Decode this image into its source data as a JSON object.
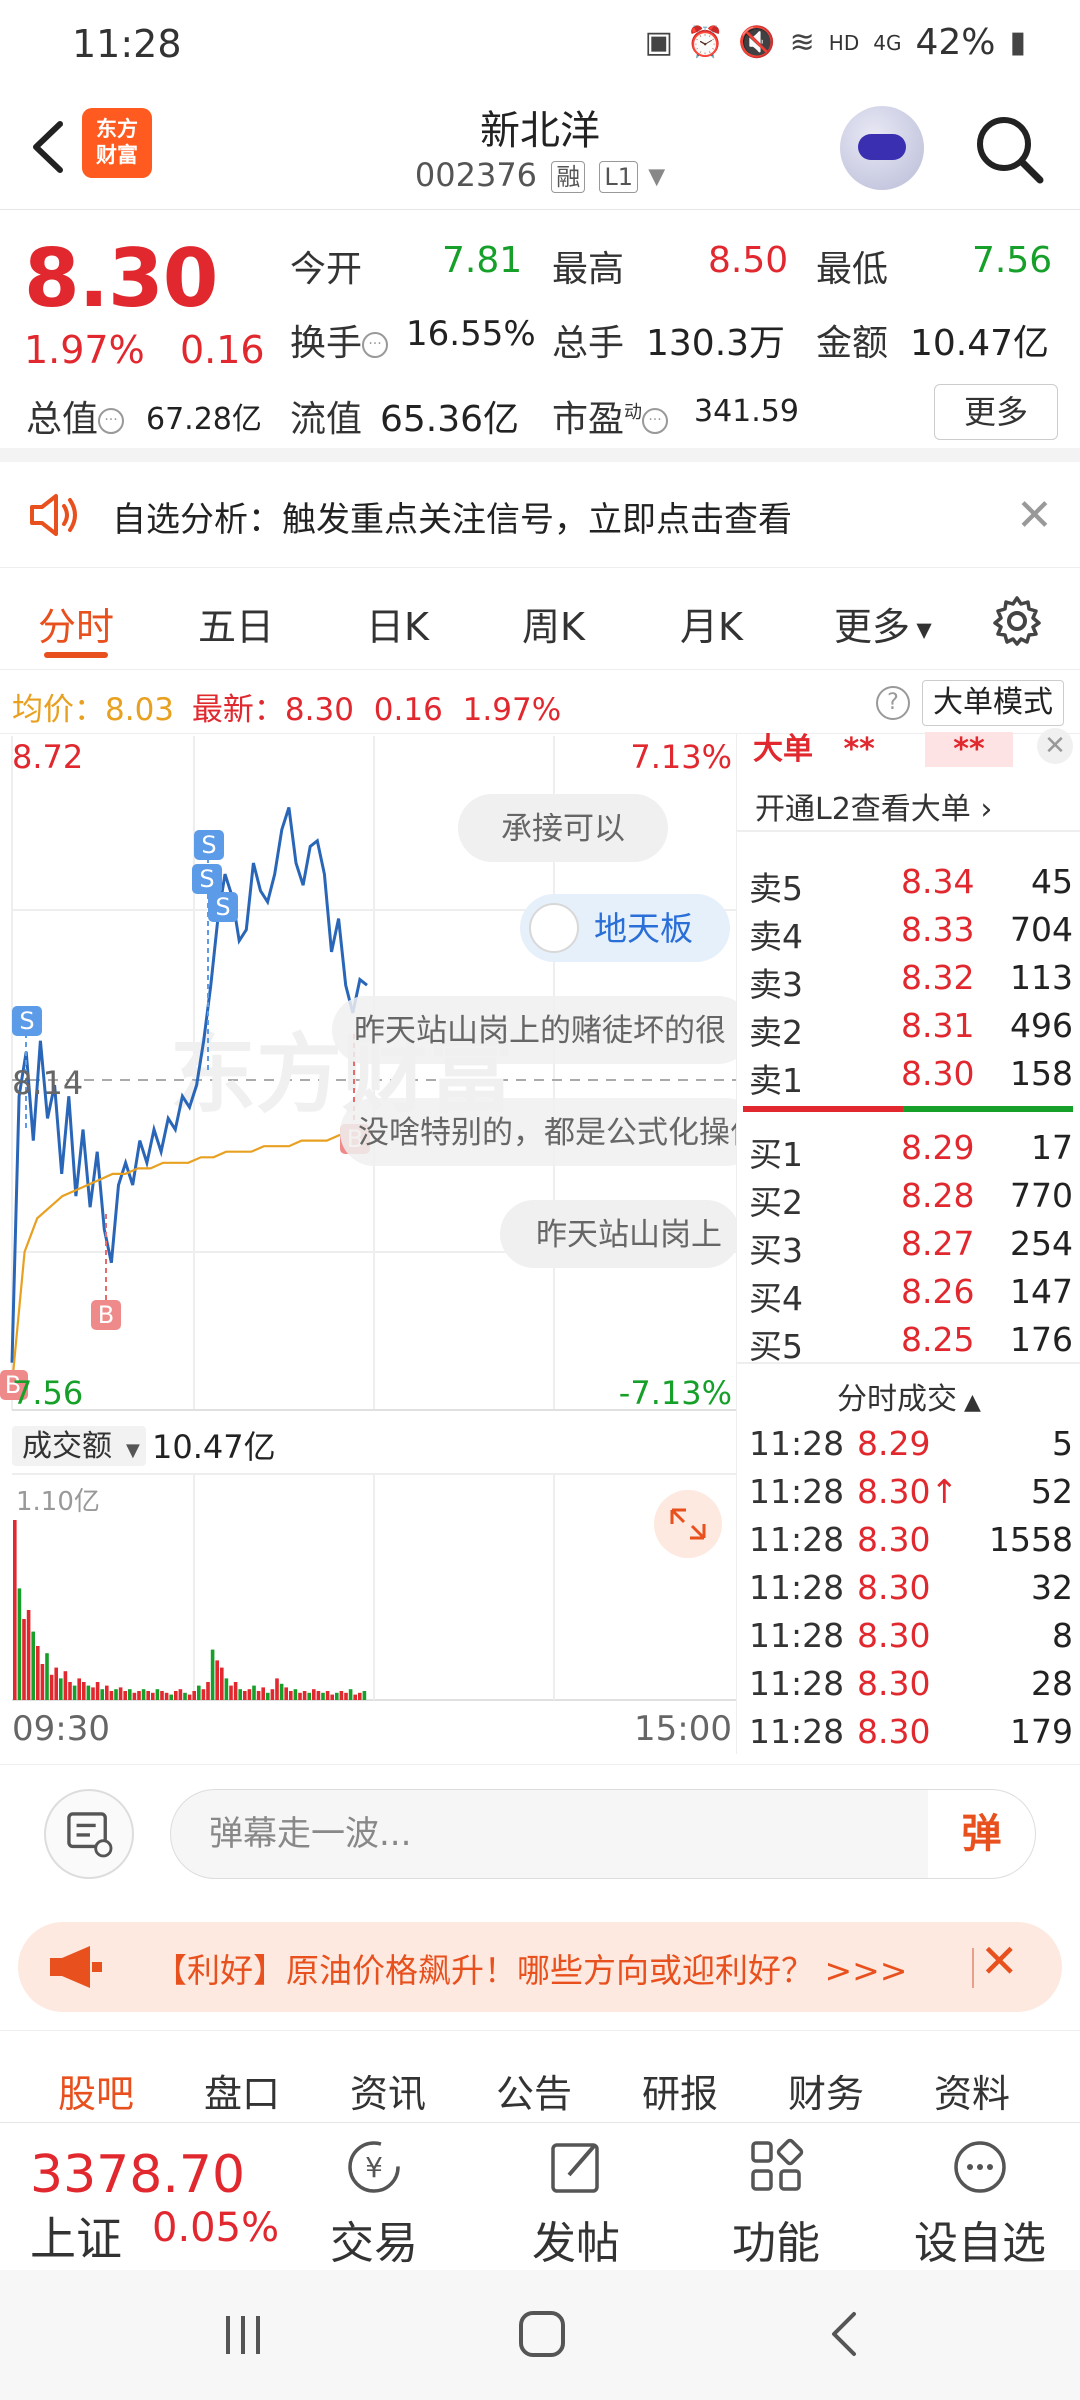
{
  "status_bar": {
    "time": "11:28",
    "network": "HD",
    "signal": "4G",
    "battery": "42%"
  },
  "header": {
    "logo_line1": "东方",
    "logo_line2": "财富",
    "stock_name": "新北洋",
    "stock_code": "002376",
    "tag_margin": "融",
    "tag_level": "L1"
  },
  "quote": {
    "price": "8.30",
    "change_pct": "1.97%",
    "change": "0.16",
    "open_label": "今开",
    "open": "7.81",
    "high_label": "最高",
    "high": "8.50",
    "low_label": "最低",
    "low": "7.56",
    "turnover_label": "换手",
    "turnover": "16.55%",
    "volume_label": "总手",
    "volume": "130.3万",
    "amount_label": "金额",
    "amount": "10.47亿",
    "mcap_label": "总值",
    "mcap": "67.28亿",
    "float_label": "流值",
    "float": "65.36亿",
    "pe_label": "市盈",
    "pe_sup": "动",
    "pe": "341.59",
    "more": "更多"
  },
  "notice": {
    "text": "自选分析：触发重点关注信号，立即点击查看"
  },
  "tabs": [
    "分时",
    "五日",
    "日K",
    "周K",
    "月K",
    "更多"
  ],
  "avg_row": {
    "avg_label": "均价：",
    "avg_value": "8.03",
    "latest_label": "最新：",
    "latest_value": "8.30",
    "latest_change": "0.16",
    "latest_pct": "1.97%",
    "help": "?",
    "big_mode": "大单模式"
  },
  "chart": {
    "y_high": "8.72",
    "y_mid": "8.14",
    "y_low": "7.56",
    "pct_high": "7.13%",
    "pct_low": "-7.13%",
    "time_start": "09:30",
    "time_end": "15:00",
    "bubbles": [
      "承接可以",
      "地天板",
      "昨天站山岗上的赌徒坏的很",
      "没啥特别的，都是公式化操作",
      "昨天站山岗上"
    ],
    "signals": {
      "sell": "S",
      "buy": "B"
    },
    "watermark": "东方财富"
  },
  "chart_data": {
    "type": "line",
    "ylim": [
      7.56,
      8.72
    ],
    "series": [
      {
        "values": [
          7.62,
          8.1,
          8.18,
          8.02,
          8.2,
          8.06,
          8.12,
          7.96,
          8.1,
          7.92,
          8.04,
          7.9,
          8.0,
          7.86,
          7.8,
          7.94,
          7.98,
          7.94,
          8.02,
          7.98,
          8.04,
          8.0,
          8.06,
          8.04,
          8.1,
          8.08,
          8.12,
          8.2,
          8.3,
          8.42,
          8.5,
          8.46,
          8.38,
          8.4,
          8.52,
          8.47,
          8.45,
          8.5,
          8.58,
          8.62,
          8.52,
          8.48,
          8.55,
          8.56,
          8.5,
          8.36,
          8.42,
          8.3,
          8.25,
          8.31,
          8.3
        ]
      },
      {
        "values": [
          7.58,
          7.82,
          7.88,
          7.9,
          7.92,
          7.93,
          7.94,
          7.95,
          7.96,
          7.96,
          7.97,
          7.97,
          7.98,
          7.98,
          7.98,
          7.99,
          7.99,
          8.0,
          8.0,
          8.0,
          8.01,
          8.01,
          8.01,
          8.02,
          8.02,
          8.02,
          8.03,
          8.03
        ]
      }
    ]
  },
  "volume": {
    "label": "成交额",
    "value": "10.47亿",
    "max_label": "1.10亿"
  },
  "book": {
    "title": "大单",
    "title_note1": "**",
    "title_note2": "**",
    "l2_link": "开通L2查看大单",
    "asks": [
      {
        "l": "卖5",
        "p": "8.34",
        "v": "45"
      },
      {
        "l": "卖4",
        "p": "8.33",
        "v": "704"
      },
      {
        "l": "卖3",
        "p": "8.32",
        "v": "113"
      },
      {
        "l": "卖2",
        "p": "8.31",
        "v": "496"
      },
      {
        "l": "卖1",
        "p": "8.30",
        "v": "158"
      }
    ],
    "bids": [
      {
        "l": "买1",
        "p": "8.29",
        "v": "17"
      },
      {
        "l": "买2",
        "p": "8.28",
        "v": "770"
      },
      {
        "l": "买3",
        "p": "8.27",
        "v": "254"
      },
      {
        "l": "买4",
        "p": "8.26",
        "v": "147"
      },
      {
        "l": "买5",
        "p": "8.25",
        "v": "176"
      }
    ],
    "ticks_title": "分时成交",
    "ticks": [
      {
        "t": "11:28",
        "p": "8.29",
        "v": "5"
      },
      {
        "t": "11:28",
        "p": "8.30↑",
        "v": "52"
      },
      {
        "t": "11:28",
        "p": "8.30",
        "v": "1558"
      },
      {
        "t": "11:28",
        "p": "8.30",
        "v": "32"
      },
      {
        "t": "11:28",
        "p": "8.30",
        "v": "8"
      },
      {
        "t": "11:28",
        "p": "8.30",
        "v": "28"
      },
      {
        "t": "11:28",
        "p": "8.30",
        "v": "179"
      }
    ]
  },
  "danmu": {
    "placeholder": "弹幕走一波...",
    "button": "弹"
  },
  "news": {
    "text": "【利好】原油价格飙升！哪些方向或迎利好？ >>>"
  },
  "bottom_tabs": [
    "股吧",
    "盘口",
    "资讯",
    "公告",
    "研报",
    "财务",
    "资料"
  ],
  "toolbar": {
    "index_price": "3378.70",
    "index_name": "上证",
    "index_pct": "0.05%",
    "trade": "交易",
    "post": "发帖",
    "func": "功能",
    "add": "设自选"
  },
  "colors": {
    "up": "#e0282e",
    "down": "#16a02a",
    "accent": "#e8501e",
    "avg": "#e8a020",
    "line": "#2a66b8"
  }
}
